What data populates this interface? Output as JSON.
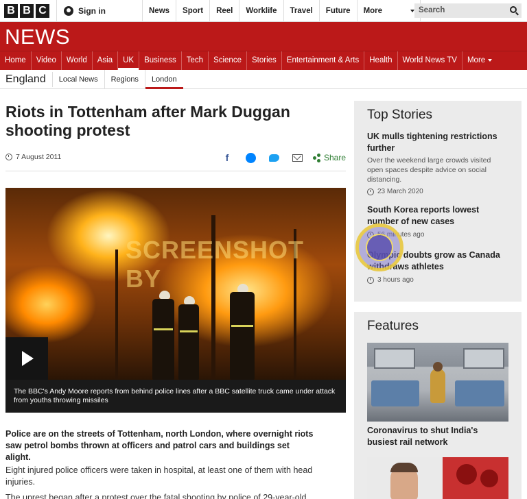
{
  "topbar": {
    "logo": [
      "B",
      "B",
      "C"
    ],
    "signin_label": "Sign in",
    "nav": [
      "News",
      "Sport",
      "Reel",
      "Worklife",
      "Travel",
      "Future"
    ],
    "more_label": "More",
    "search_placeholder": "Search"
  },
  "header": {
    "brand": "NEWS"
  },
  "section_nav": {
    "items": [
      "Home",
      "Video",
      "World",
      "Asia",
      "UK",
      "Business",
      "Tech",
      "Science",
      "Stories",
      "Entertainment & Arts",
      "Health",
      "World News TV"
    ],
    "active": "UK",
    "more_label": "More"
  },
  "secondary_nav": {
    "region": "England",
    "items": [
      "Local News",
      "Regions",
      "London"
    ],
    "active": "London"
  },
  "article": {
    "headline": "Riots in Tottenham after Mark Duggan shooting protest",
    "date": "7 August 2011",
    "share_label": "Share",
    "media_overlay_text": "SCREENSHOT BY",
    "caption": "The BBC's Andy Moore reports from behind police lines after a BBC satellite truck came under attack from youths throwing missiles",
    "intro": "Police are on the streets of Tottenham, north London, where overnight riots saw petrol bombs thrown at officers and patrol cars and buildings set alight.",
    "paragraph1": "Eight injured police officers were taken in hospital, at least one of them with head injuries.",
    "paragraph2": "The unrest began after a protest over the fatal shooting by police of 29-year-old"
  },
  "top_stories": {
    "title": "Top Stories",
    "stories": [
      {
        "title": "UK mulls tightening restrictions further",
        "summary": "Over the weekend large crowds visited open spaces despite advice on social distancing.",
        "time": "23 March 2020"
      },
      {
        "title": "South Korea reports lowest number of new cases",
        "time": "56 minutes ago"
      },
      {
        "title": "Olympic doubts grow as Canada withdraws athletes",
        "time": "3 hours ago"
      }
    ]
  },
  "features": {
    "title": "Features",
    "items": [
      {
        "title": "Coronavirus to shut India's busiest rail network"
      }
    ]
  },
  "colors": {
    "brand_red": "#bb1919",
    "share_green": "#2e7d32",
    "panel_grey": "#ebebeb"
  },
  "icons": [
    "user-icon",
    "chevron-down-icon",
    "search-icon",
    "clock-icon",
    "facebook-icon",
    "messenger-icon",
    "twitter-icon",
    "email-icon",
    "share-icon",
    "play-icon"
  ]
}
